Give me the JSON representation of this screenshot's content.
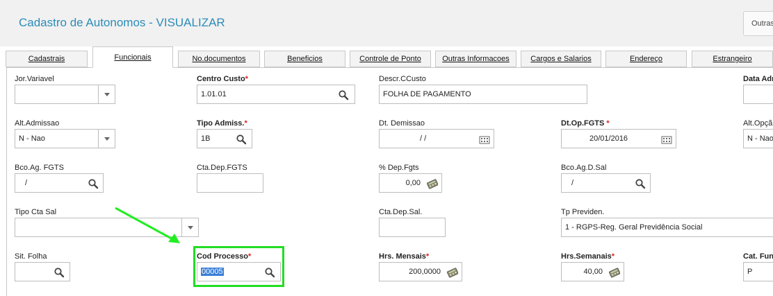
{
  "header": {
    "title": "Cadastro de Autonomos - VISUALIZAR",
    "outras_label": "Outras"
  },
  "tabs": [
    "Cadastrais",
    "Funcionais",
    "No.documentos",
    "Beneficios",
    "Controle de Ponto",
    "Outras Informacoes",
    "Cargos e Salarios",
    "Endereço",
    "Estrangeiro"
  ],
  "active_tab": "Funcionais",
  "required_mark": "*",
  "fields": {
    "jor_variavel": {
      "label": "Jor.Variavel",
      "value": ""
    },
    "centro_custo": {
      "label": "Centro Custo",
      "value": "1.01.01"
    },
    "descr_ccusto": {
      "label": "Descr.CCusto",
      "value": "FOLHA DE PAGAMENTO"
    },
    "data_admissao": {
      "label": "Data Adm"
    },
    "alt_admissao": {
      "label": "Alt.Admissao",
      "value": "N - Nao"
    },
    "tipo_admiss": {
      "label": "Tipo Admiss.",
      "value": "1B"
    },
    "dt_demissao": {
      "label": "Dt. Demissao",
      "value": "/ /"
    },
    "dt_op_fgts": {
      "label": "Dt.Op.FGTS",
      "value": "20/01/2016"
    },
    "alt_opcao": {
      "label": "Alt.Opçã",
      "value": "N - Nao"
    },
    "bco_ag_fgts": {
      "label": "Bco.Ag. FGTS",
      "value": "/"
    },
    "cta_dep_fgts": {
      "label": "Cta.Dep.FGTS",
      "value": ""
    },
    "pct_dep_fgts": {
      "label": "% Dep.Fgts",
      "value": "0,00"
    },
    "bco_ag_d_sal": {
      "label": "Bco.Ag.D.Sal",
      "value": "/"
    },
    "tipo_cta_sal": {
      "label": "Tipo Cta Sal",
      "value": ""
    },
    "cta_dep_sal": {
      "label": "Cta.Dep.Sal.",
      "value": ""
    },
    "tp_previden": {
      "label": "Tp Previden.",
      "value": "1 - RGPS-Reg. Geral Previdência Social"
    },
    "sit_folha": {
      "label": "Sit. Folha",
      "value": ""
    },
    "cod_processo": {
      "label": "Cod Processo",
      "value": "00005"
    },
    "hrs_mensais": {
      "label": "Hrs. Mensais",
      "value": "200,0000"
    },
    "hrs_semanais": {
      "label": "Hrs.Semanais",
      "value": "40,00"
    },
    "cat_func": {
      "label": "Cat. Fun",
      "value": "P"
    }
  },
  "colors": {
    "title": "#2c8cb8",
    "highlight": "#22dd22",
    "required": "#e02020",
    "selection": "#3b7fd6"
  },
  "icons": [
    "search-icon",
    "calendar-icon",
    "calculator-icon",
    "dropdown-arrow-icon"
  ]
}
